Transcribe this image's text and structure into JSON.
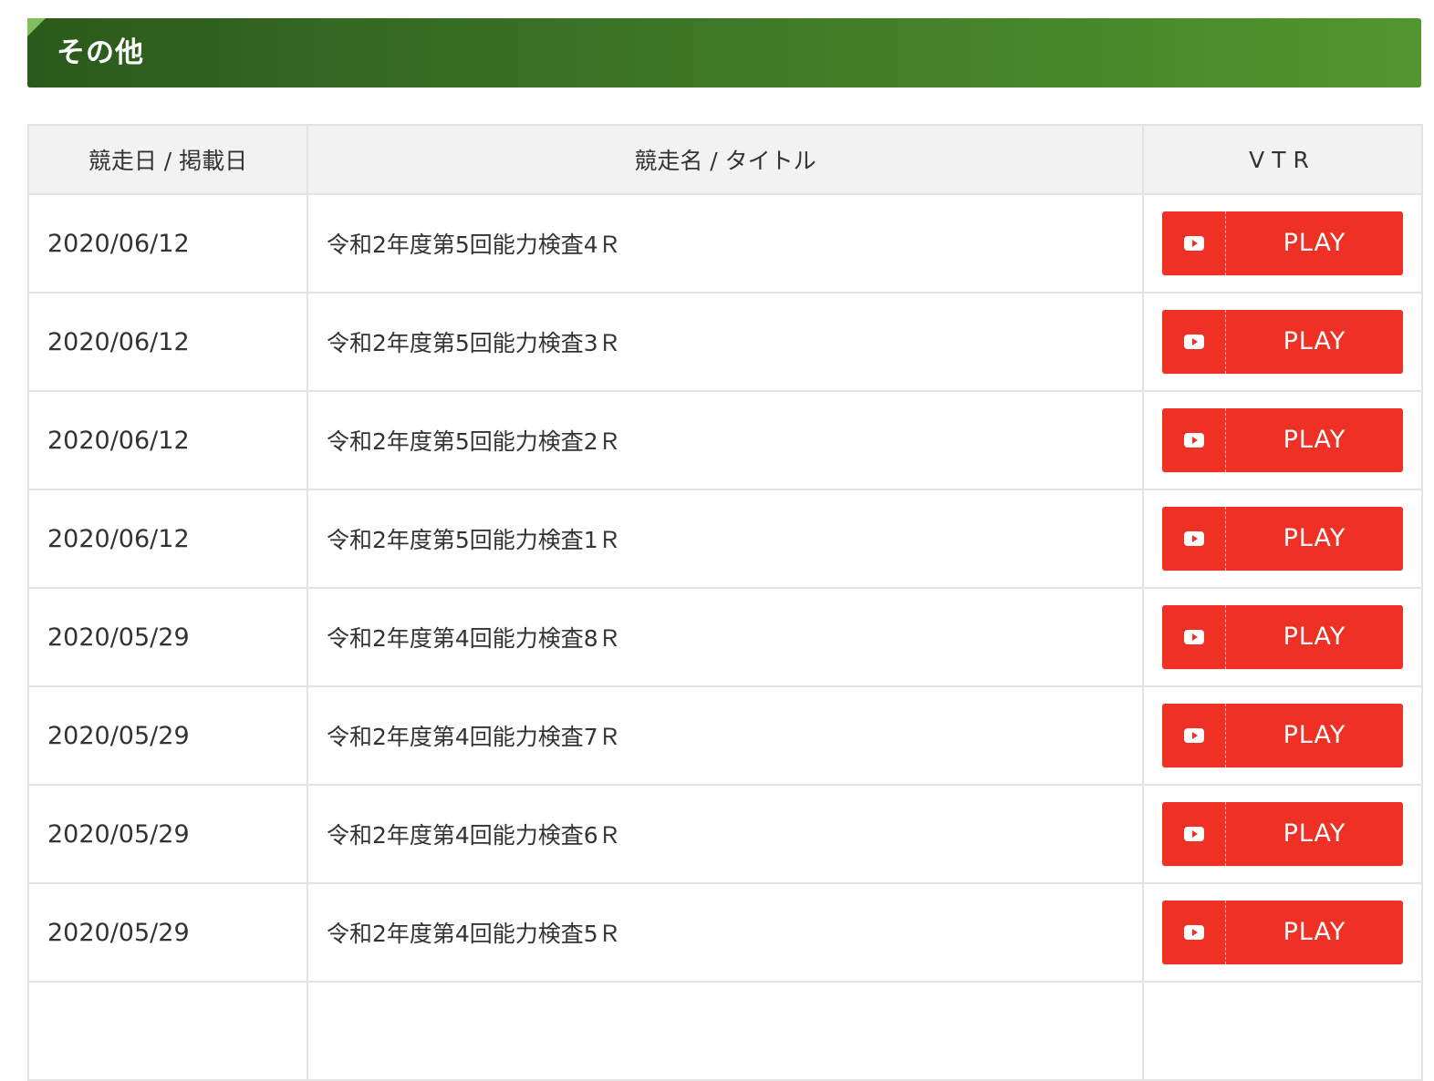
{
  "section": {
    "title": "その他",
    "accent_color": "#3d7526"
  },
  "table": {
    "headers": {
      "date": "競走日 / 掲載日",
      "title": "競走名 / タイトル",
      "vtr": "VTR"
    },
    "play_label": "PLAY",
    "play_icon": "youtube-play-icon",
    "play_color": "#ee3124",
    "rows": [
      {
        "date": "2020/06/12",
        "title": "令和2年度第5回能力検査4Ｒ"
      },
      {
        "date": "2020/06/12",
        "title": "令和2年度第5回能力検査3Ｒ"
      },
      {
        "date": "2020/06/12",
        "title": "令和2年度第5回能力検査2Ｒ"
      },
      {
        "date": "2020/06/12",
        "title": "令和2年度第5回能力検査1Ｒ"
      },
      {
        "date": "2020/05/29",
        "title": "令和2年度第4回能力検査8Ｒ"
      },
      {
        "date": "2020/05/29",
        "title": "令和2年度第4回能力検査7Ｒ"
      },
      {
        "date": "2020/05/29",
        "title": "令和2年度第4回能力検査6Ｒ"
      },
      {
        "date": "2020/05/29",
        "title": "令和2年度第4回能力検査5Ｒ"
      },
      {
        "date": "",
        "title": ""
      }
    ]
  }
}
